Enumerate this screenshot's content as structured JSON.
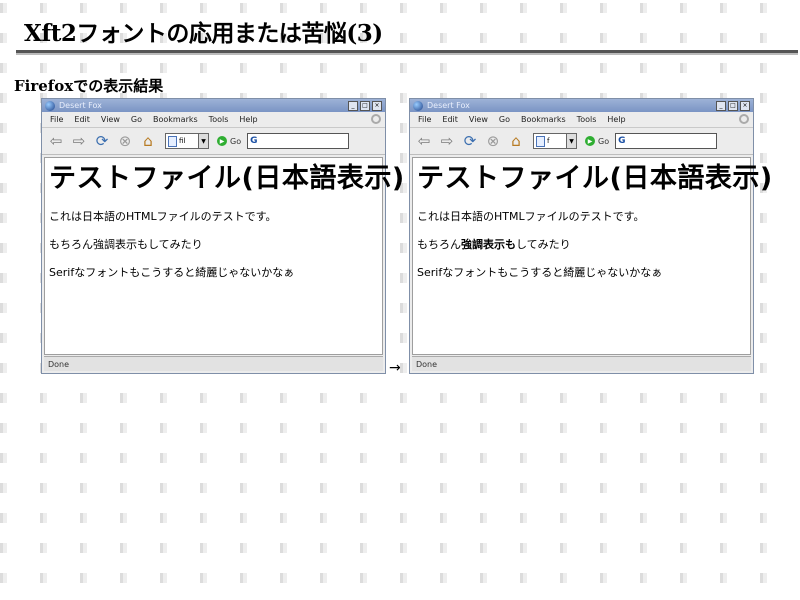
{
  "slide": {
    "title": "Xft2フォントの応用または苦悩(3)",
    "section_label": "Firefoxでの表示結果",
    "arrow": "→"
  },
  "browser": {
    "window_title": "Desert Fox",
    "menu": [
      "File",
      "Edit",
      "View",
      "Go",
      "Bookmarks",
      "Tools",
      "Help"
    ],
    "go_label": "Go",
    "status": "Done"
  },
  "left_window": {
    "url_text": "fil",
    "heading": "テストファイル(日本語表示)",
    "line1": "これは日本語のHTMLファイルのテストです。",
    "line2_before": "もちろん強調表示もしてみたり",
    "line2_bold": "",
    "line2_after": "",
    "line3": "Serifなフォントもこうすると綺麗じゃないかなぁ"
  },
  "right_window": {
    "url_text": "f",
    "heading": "テストファイル(日本語表示)",
    "line1": "これは日本語のHTMLファイルのテストです。",
    "line2_before": "もちろん",
    "line2_bold": "強調表示も",
    "line2_after": "してみたり",
    "line3": "Serifなフォントもこうすると綺麗じゃないかなぁ"
  }
}
